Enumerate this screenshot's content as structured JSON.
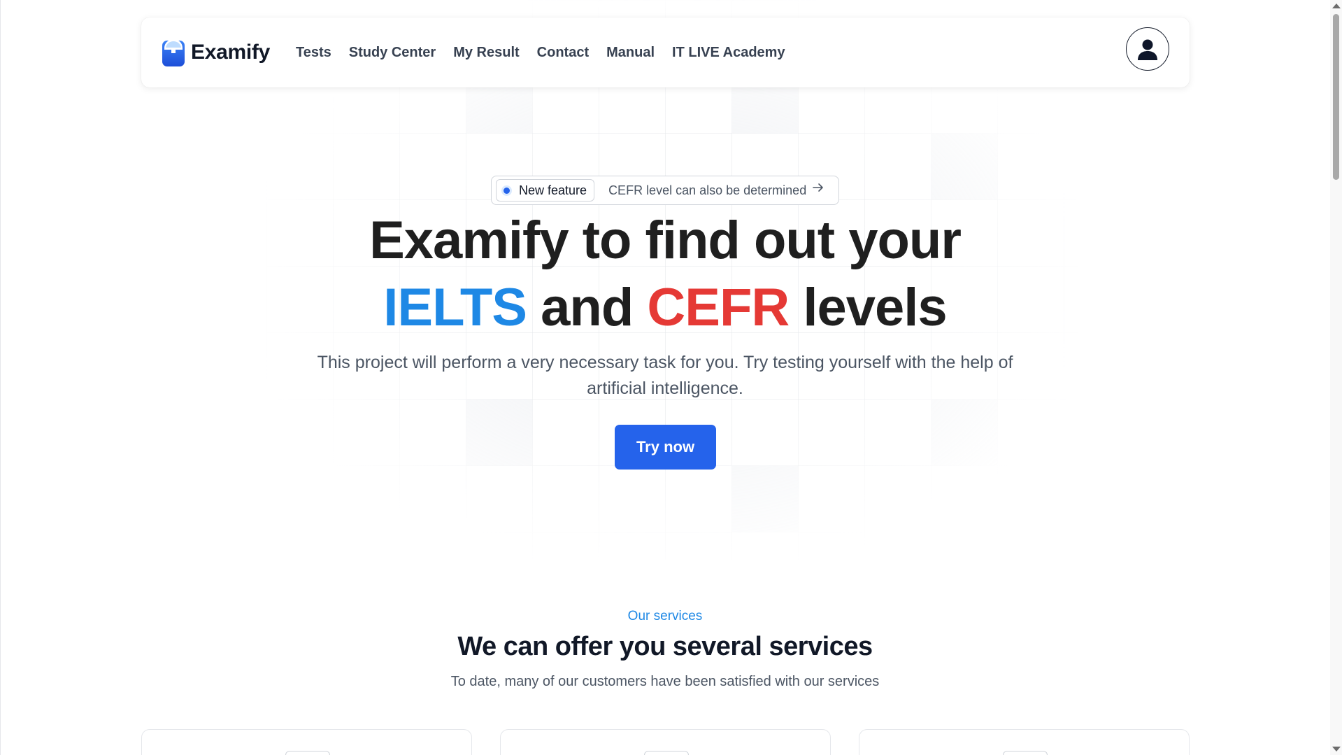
{
  "navbar": {
    "brand_name": "Examify",
    "links": [
      "Tests",
      "Study Center",
      "My Result",
      "Contact",
      "Manual",
      "IT LIVE Academy"
    ]
  },
  "hero": {
    "badge_label": "New feature",
    "badge_text": "CEFR level can also be determined",
    "title_line1": "Examify to find out your",
    "title_ielts": "IELTS",
    "title_and": "and",
    "title_cefr": "CEFR",
    "title_levels": "levels",
    "subtitle": "This project will perform a very necessary task for you. Try testing yourself with the help of artificial intelligence.",
    "cta_label": "Try now"
  },
  "services": {
    "kicker": "Our services",
    "title": "We can offer you several services",
    "subtitle": "To date, many of our customers have been satisfied with our services"
  },
  "colors": {
    "accent": "#2563eb",
    "ielts": "#1e88e5",
    "cefr": "#e53935"
  }
}
